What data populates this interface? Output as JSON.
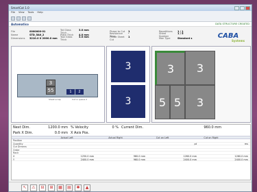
{
  "window": {
    "title": "SmartCut 1.0"
  },
  "menu": [
    "File",
    "View",
    "Tools",
    "Help"
  ],
  "header": {
    "title": "Automatico",
    "status": "DATA STRUCTURE CREATED"
  },
  "info": [
    [
      {
        "k": "File",
        "v": "0000000-01"
      },
      {
        "k": "Tot Glass Thick",
        "v": "3.0 mm"
      },
      {
        "k": "Phase to Cut",
        "v": "1"
      },
      {
        "k": "Repetitions",
        "v": "1 / 1"
      }
    ],
    [
      {
        "k": "Name",
        "v": "STD_5A0_2"
      },
      {
        "k": "Plate Thick",
        "v": "4.0 mm"
      },
      {
        "k": "Resistance Time",
        "v": "-"
      },
      {
        "k": "Sheet Number",
        "v": "1 / 5"
      }
    ],
    [
      {
        "k": "Dimensions",
        "v": "3210.0 X 2000.0 mm"
      },
      {
        "k": "Tool Glass Thick",
        "v": "3.0 mm"
      },
      {
        "k": "Phase Sheet Cut",
        "v": "1"
      },
      {
        "k": "Man Type",
        "v": "Standard s"
      }
    ]
  ],
  "logo": {
    "text": "CABA",
    "sub": "Systems"
  },
  "panel1": {
    "cell_labels": [
      "3",
      "55"
    ],
    "navy_labels": [
      "1",
      "2"
    ],
    "caption1": "Sheet scrap",
    "caption2": "Cut in queue 2"
  },
  "panel2": {
    "labels": [
      "3",
      "3"
    ]
  },
  "panel3": {
    "cells": [
      "3",
      "3",
      "5",
      "5",
      "3"
    ]
  },
  "dims": {
    "next_dim_label": "Next Dim.",
    "next_dim_value": "1200.0 mm",
    "velocity_label": "% Velocity",
    "velocity_value": "0 %",
    "current_dim_label": "Current Dim.",
    "current_dim_value": "960.0 mm",
    "park_label": "Park X Dim.",
    "park_value": "0.0 mm",
    "xaxis_label": "X Axis Pos.",
    "xaxis_value": ""
  },
  "table": {
    "headers": [
      "",
      "Actual Left",
      "Actual Right",
      "Cut on Left",
      "Cut on Right"
    ],
    "rows": [
      [
        "Position",
        "",
        "",
        "",
        ""
      ],
      [
        "Quantity",
        "",
        "",
        "pt",
        "ms"
      ],
      [
        "Cut Dimens",
        "",
        "",
        "",
        ""
      ],
      [
        "Order",
        "",
        "",
        "",
        ""
      ],
      [
        "Rack",
        "",
        "",
        "",
        ""
      ],
      [
        "X",
        "1250.0 mm",
        "960.0 mm",
        "1260.0 mm",
        "1260.0 mm"
      ],
      [
        "Y",
        "2400.0 mm",
        "960.0 mm",
        "2400.0 mm",
        "2400.0 mm"
      ]
    ]
  },
  "colors": {
    "navy": "#1f2d6e",
    "sheet": "#a9b8c6",
    "cell": "#888888",
    "accent": "#1e4fa3"
  }
}
